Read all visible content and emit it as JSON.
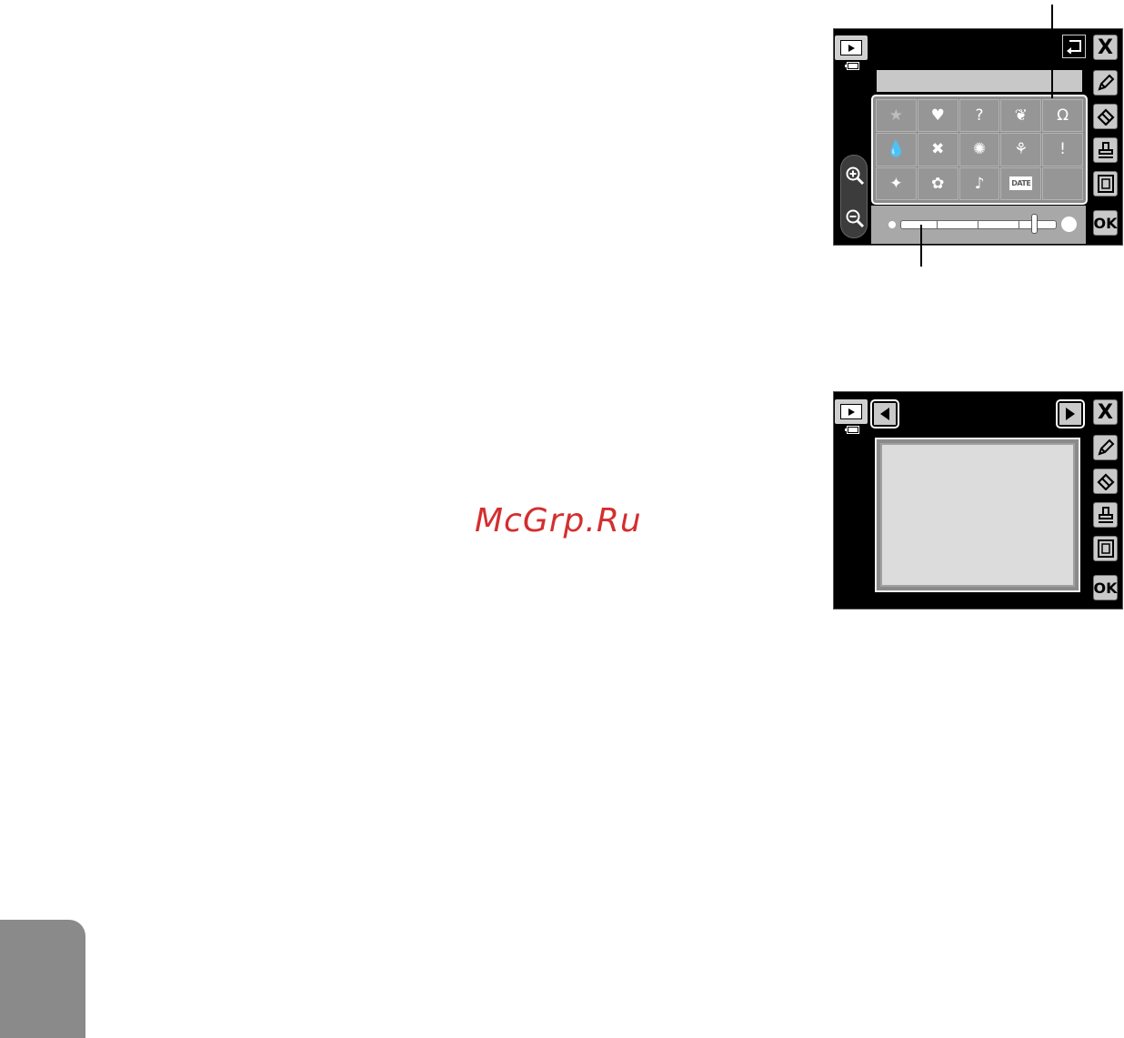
{
  "watermark": "McGrp.Ru",
  "screen_top": {
    "stamp_grid": [
      {
        "icon": "star",
        "glyph": "★"
      },
      {
        "icon": "heart",
        "glyph": "♥"
      },
      {
        "icon": "question",
        "glyph": "?"
      },
      {
        "icon": "leaf",
        "glyph": "❦"
      },
      {
        "icon": "horseshoe",
        "glyph": "Ω"
      },
      {
        "icon": "drop",
        "glyph": "💧"
      },
      {
        "icon": "butterfly",
        "glyph": "✖"
      },
      {
        "icon": "sun",
        "glyph": "✺"
      },
      {
        "icon": "ribbon",
        "glyph": "⚘"
      },
      {
        "icon": "exclamation",
        "glyph": "!"
      },
      {
        "icon": "sparkle",
        "glyph": "✦"
      },
      {
        "icon": "flower",
        "glyph": "✿"
      },
      {
        "icon": "note",
        "glyph": "♪"
      },
      {
        "icon": "date",
        "glyph": "DATE"
      },
      {
        "icon": "empty",
        "glyph": ""
      }
    ],
    "size_slider": {
      "value_fraction": 0.86
    }
  },
  "buttons": {
    "close": "X",
    "ok": "OK"
  },
  "colors": {
    "screen_bg": "#000000",
    "button_bg": "#c9c9c9",
    "grid_bg": "#8c8c8c",
    "watermark": "#d32f2f",
    "side_tab": "#8a8a8a"
  }
}
